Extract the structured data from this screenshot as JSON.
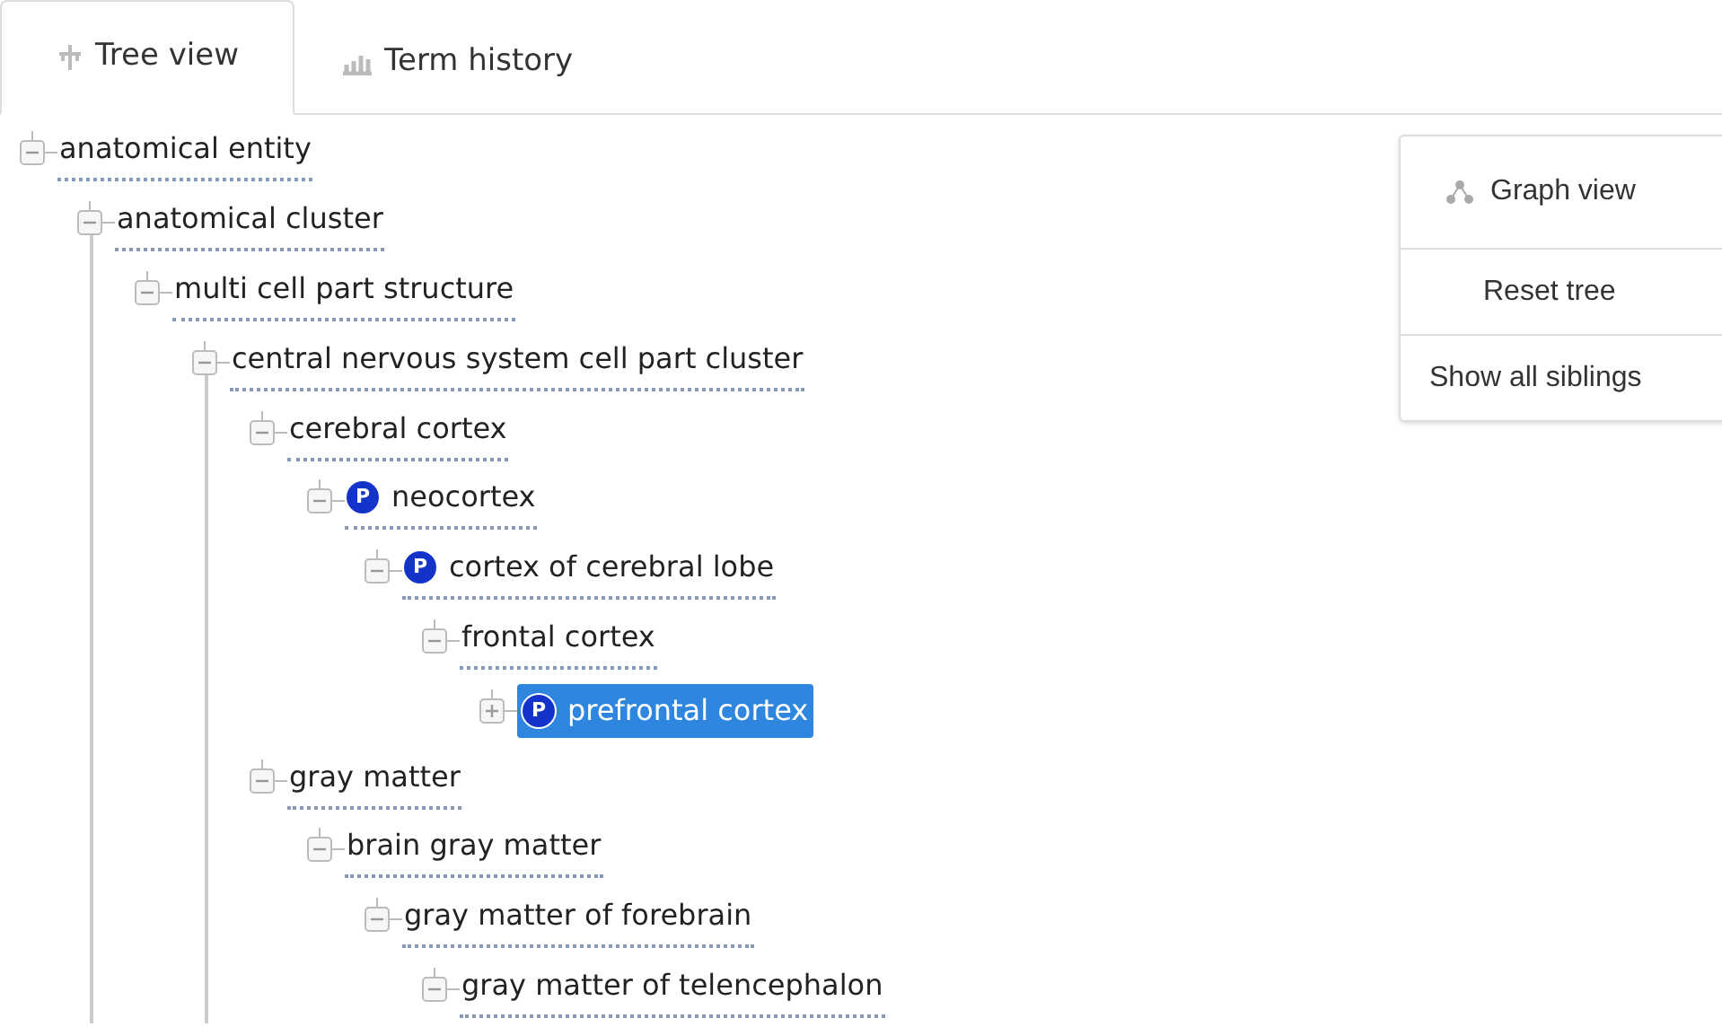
{
  "tabs": [
    {
      "label": "Tree view",
      "selected": true
    },
    {
      "label": "Term history",
      "selected": false
    }
  ],
  "tree": [
    {
      "label": "anatomical entity",
      "expanded": true,
      "selected": false,
      "children": [
        {
          "label": "anatomical cluster",
          "expanded": true,
          "selected": false,
          "continues": true,
          "children": [
            {
              "label": "multi cell part structure",
              "expanded": true,
              "selected": false,
              "children": [
                {
                  "label": "central nervous system cell part cluster",
                  "expanded": true,
                  "selected": false,
                  "continues": true,
                  "children": [
                    {
                      "label": "cerebral cortex",
                      "expanded": true,
                      "selected": false,
                      "children": [
                        {
                          "label": "neocortex",
                          "badge": "P",
                          "expanded": true,
                          "selected": false,
                          "children": [
                            {
                              "label": "cortex of cerebral lobe",
                              "badge": "P",
                              "expanded": true,
                              "selected": false,
                              "children": [
                                {
                                  "label": "frontal cortex",
                                  "expanded": true,
                                  "selected": false,
                                  "children": [
                                    {
                                      "label": "prefrontal cortex",
                                      "badge": "P",
                                      "expanded": false,
                                      "selected": true
                                    }
                                  ]
                                }
                              ]
                            }
                          ]
                        }
                      ]
                    },
                    {
                      "label": "gray matter",
                      "expanded": true,
                      "selected": false,
                      "children": [
                        {
                          "label": "brain gray matter",
                          "expanded": true,
                          "selected": false,
                          "children": [
                            {
                              "label": "gray matter of forebrain",
                              "expanded": true,
                              "selected": false,
                              "children": [
                                {
                                  "label": "gray matter of telencephalon",
                                  "expanded": true,
                                  "selected": false
                                }
                              ]
                            }
                          ]
                        }
                      ]
                    }
                  ]
                }
              ]
            }
          ]
        }
      ]
    }
  ],
  "side_menu": [
    {
      "label": "Graph view"
    },
    {
      "label": "Reset tree"
    },
    {
      "label": "Show all siblings"
    }
  ]
}
